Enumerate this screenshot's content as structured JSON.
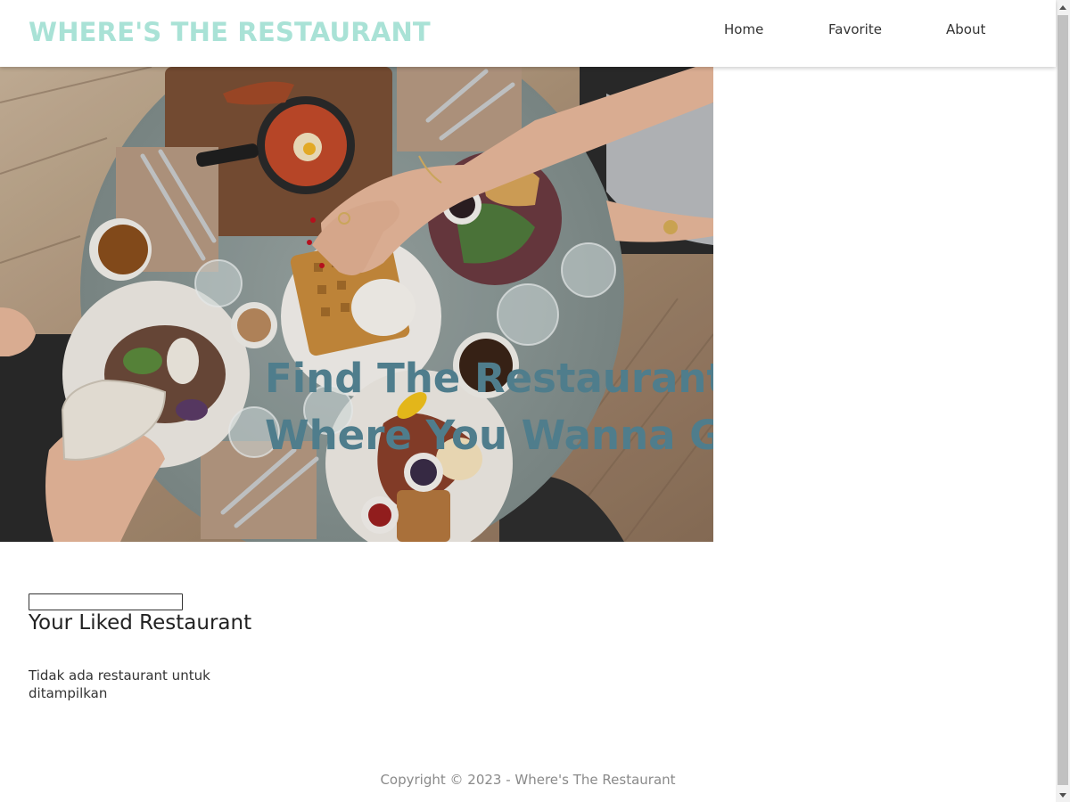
{
  "header": {
    "brand": "WHERE'S THE RESTAURANT",
    "nav": [
      {
        "label": "Home"
      },
      {
        "label": "Favorite"
      },
      {
        "label": "About"
      }
    ]
  },
  "hero": {
    "title_line1": "Find The Restaurant",
    "title_line2": "Where You Wanna Go"
  },
  "liked": {
    "search_value": "",
    "heading": "Your Liked Restaurant",
    "empty_message": "Tidak ada restaurant untuk ditampilkan"
  },
  "footer": {
    "copyright": "Copyright © 2023 - Where's The Restaurant"
  },
  "colors": {
    "brand": "#a9e2d6",
    "hero_title": "#4f7d8c",
    "footer_text": "#8a8a8a"
  },
  "icons": {
    "scroll_up": "scroll-up-arrow-icon",
    "scroll_down": "scroll-down-arrow-icon"
  }
}
